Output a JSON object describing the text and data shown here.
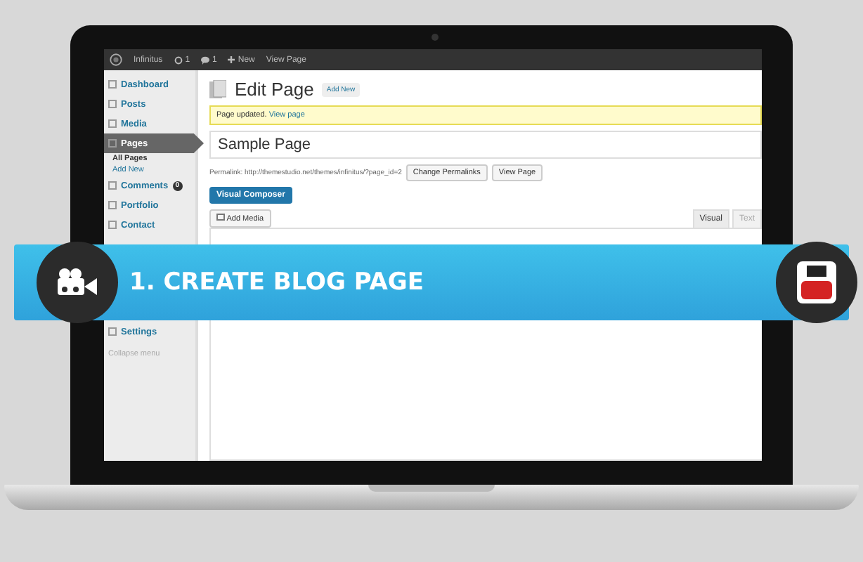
{
  "admin_bar": {
    "site": "Infinitus",
    "updates": "1",
    "comments": "1",
    "new": "New",
    "view": "View Page"
  },
  "sidebar": {
    "items": [
      {
        "label": "Dashboard",
        "kind": "menu",
        "selected": false
      },
      {
        "label": "Posts",
        "kind": "menu",
        "selected": false
      },
      {
        "label": "Media",
        "kind": "menu",
        "selected": false
      },
      {
        "label": "Pages",
        "kind": "menu",
        "selected": true
      },
      {
        "label": "All Pages",
        "kind": "sub",
        "selected": true
      },
      {
        "label": "Add New",
        "kind": "sub",
        "selected": false
      },
      {
        "label": "Comments",
        "kind": "menu",
        "selected": false,
        "badge": "0"
      },
      {
        "label": "Portfolio",
        "kind": "menu",
        "selected": false
      },
      {
        "label": "Contact",
        "kind": "menu",
        "selected": false
      },
      {
        "kind": "gap"
      },
      {
        "label": "Settings",
        "kind": "menu",
        "selected": false
      },
      {
        "label": "Collapse menu",
        "kind": "collapse"
      }
    ]
  },
  "header": {
    "title": "Edit Page",
    "add_new": "Add New"
  },
  "notice": {
    "text": "Page updated.",
    "link": "View page"
  },
  "title_field": {
    "value": "Sample Page"
  },
  "permalink": {
    "label": "Permalink:",
    "url": "http://themestudio.net/themes/infinitus/?page_id=2",
    "buttons": [
      "Change Permalinks",
      "View Page"
    ]
  },
  "composer_button": "Visual Composer",
  "add_media": "Add Media",
  "editor_tabs": [
    {
      "label": "Visual",
      "selected": true
    },
    {
      "label": "Text",
      "selected": false
    }
  ],
  "banner": {
    "title": "1. CREATE BLOG PAGE"
  }
}
